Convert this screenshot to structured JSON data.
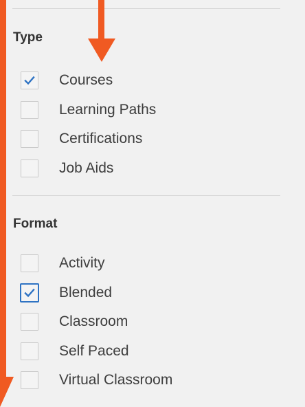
{
  "filters": {
    "type": {
      "title": "Type",
      "items": [
        {
          "label": "Courses",
          "checked": true
        },
        {
          "label": "Learning Paths",
          "checked": false
        },
        {
          "label": "Certifications",
          "checked": false
        },
        {
          "label": "Job Aids",
          "checked": false
        }
      ]
    },
    "format": {
      "title": "Format",
      "items": [
        {
          "label": "Activity",
          "checked": false
        },
        {
          "label": "Blended",
          "checked": true
        },
        {
          "label": "Classroom",
          "checked": false
        },
        {
          "label": "Self Paced",
          "checked": false
        },
        {
          "label": "Virtual Classroom",
          "checked": false
        }
      ]
    }
  },
  "colors": {
    "annotation": "#f05a22",
    "check": "#2f73c3",
    "background": "#f1f1f1"
  }
}
